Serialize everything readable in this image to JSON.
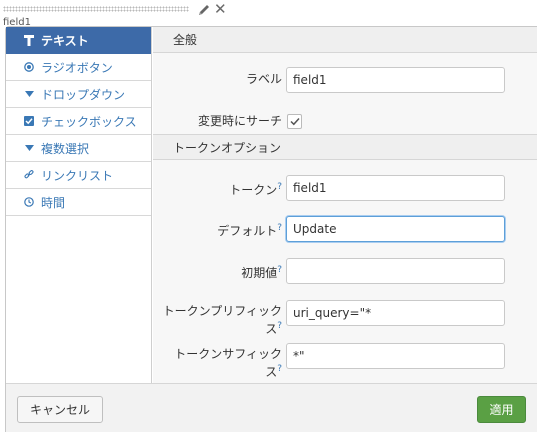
{
  "top": {
    "field_label": "field1"
  },
  "sidebar": {
    "items": [
      {
        "label": "テキスト",
        "icon": "text-icon"
      },
      {
        "label": "ラジオボタン",
        "icon": "radio-icon"
      },
      {
        "label": "ドロップダウン",
        "icon": "dropdown-caret-icon"
      },
      {
        "label": "チェックボックス",
        "icon": "checkbox-icon"
      },
      {
        "label": "複数選択",
        "icon": "multiselect-caret-icon"
      },
      {
        "label": "リンクリスト",
        "icon": "link-icon"
      },
      {
        "label": "時間",
        "icon": "clock-icon"
      }
    ],
    "active_index": 0
  },
  "general": {
    "title": "全般",
    "label_label": "ラベル",
    "label_value": "field1",
    "search_on_change_label": "変更時にサーチ",
    "search_on_change_checked": true
  },
  "token_options": {
    "title": "トークンオプション",
    "help_mark": "?",
    "token_label": "トークン",
    "token_value": "field1",
    "default_label": "デフォルト",
    "default_value": "Update",
    "initial_label": "初期値",
    "initial_value": "",
    "prefix_label_1": "トークンプリフィック",
    "prefix_label_2": "ス",
    "prefix_value": "uri_query=\"*",
    "suffix_label_1": "トークンサフィック",
    "suffix_label_2": "ス",
    "suffix_value": "*\""
  },
  "footer": {
    "cancel_label": "キャンセル",
    "apply_label": "適用"
  },
  "colors": {
    "active_bg": "#3d6aa8",
    "link": "#3a78b5",
    "apply_bg": "#5aa044",
    "focus_border": "#5d9fd8"
  }
}
